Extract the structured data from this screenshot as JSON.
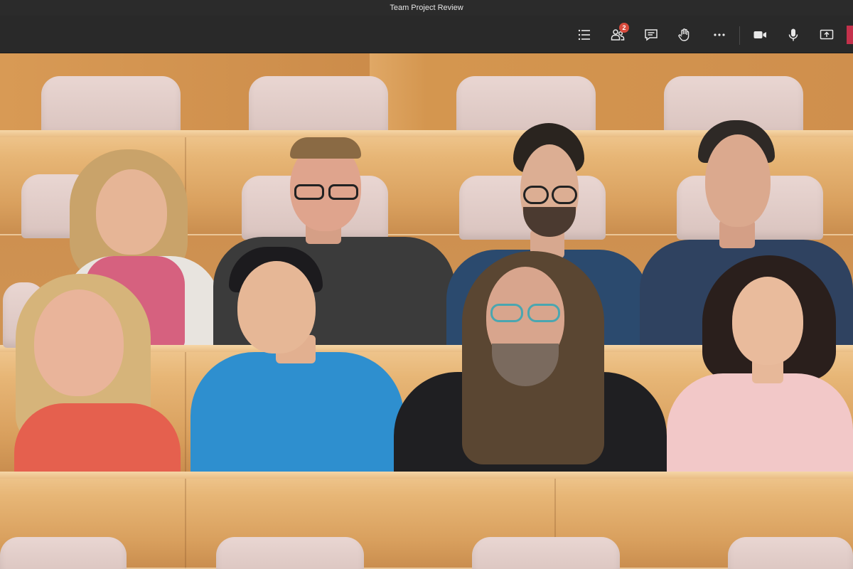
{
  "window": {
    "title": "Team Project Review"
  },
  "toolbar": {
    "participants_badge": "2",
    "icons": [
      "list-icon",
      "participants-icon",
      "chat-icon",
      "raise-hand-icon",
      "more-icon",
      "camera-icon",
      "microphone-icon",
      "share-screen-icon"
    ],
    "leave_color": "#c4314b"
  },
  "meeting": {
    "view": "Together mode",
    "scene": "auditorium",
    "participant_count": 8
  }
}
